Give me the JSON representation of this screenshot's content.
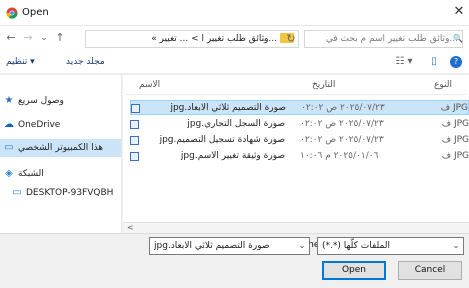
{
  "window": {
    "title": "Open",
    "close_glyph": "✕"
  },
  "nav": {
    "back_glyph": "←",
    "forward_glyph": "→",
    "recent_glyph": "⌄",
    "up_glyph": "↑",
    "breadcrumb": "...وثائق طلب تغيير ا  >  ... تغيير  »",
    "breadcrumb_caret": "⌄",
    "refresh_glyph": "↻",
    "search_placeholder": "...وثائق طلب تغيير اسم م بحث في",
    "search_glyph": "🔍"
  },
  "toolbar": {
    "organize": "تنظيم ▾",
    "new_folder": "مجلد جديد",
    "view_glyph": "☷ ▾",
    "pane_glyph": "▯",
    "help_glyph": "?"
  },
  "sidebar": {
    "items": [
      {
        "label": "وصول سريع",
        "icon": "★",
        "icon_name": "star-icon"
      },
      {
        "label": "OneDrive",
        "icon": "☁",
        "icon_name": "cloud-icon"
      },
      {
        "label": "هذا الكمبيوتر الشخصي",
        "icon": "▭",
        "icon_name": "computer-icon"
      },
      {
        "label": "الشبكة",
        "icon": "◈",
        "icon_name": "network-icon"
      },
      {
        "label": "DESKTOP-93FVQBH",
        "icon": "▭",
        "icon_name": "computer-icon"
      }
    ]
  },
  "columns": {
    "name": "الاسم",
    "date": "التاريخ",
    "type": "النوع"
  },
  "files": [
    {
      "name": "صورة التصميم ثلاثي الابعاد.jpg",
      "date": "٢٠٢٥/٠٧/٢٣ ص ٠٢:٠٢",
      "type": "JPG ف"
    },
    {
      "name": "صورة السجل التجاري.jpg",
      "date": "٢٠٢٥/٠٧/٢٣ ص ٠٢:٠٢",
      "type": "JPG ف"
    },
    {
      "name": "صورة شهادة تسجيل التصميم.jpg",
      "date": "٢٠٢٥/٠٧/٢٣ ص ٠٢:٠٢",
      "type": "JPG ف"
    },
    {
      "name": "صورة وثيقة تغيير الاسم.jpg",
      "date": "٢٠٢٥/٠١/٠٦ م ١٠:٠٦",
      "type": "JPG ف"
    }
  ],
  "bottom": {
    "file_name_label": "File name:",
    "file_name_value": "صورة التصميم ثلاثي الابعاد.jpg",
    "file_type_value": "الملفات كلّها (*.*)",
    "open_label": "Open",
    "cancel_label": "Cancel",
    "caret": "⌄"
  },
  "colors": {
    "selection": "#cce4f7",
    "accent": "#0078d7",
    "folder": "#f2c640"
  }
}
